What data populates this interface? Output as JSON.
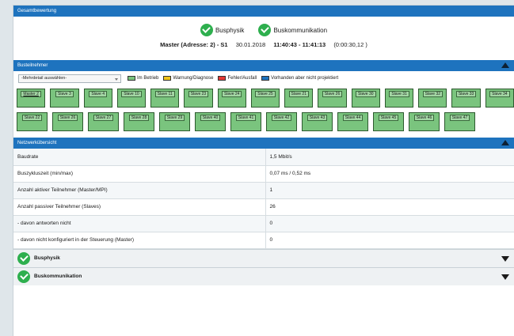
{
  "gesamtbewertung": {
    "header": "Gesamtbewertung",
    "status_items": [
      {
        "label": "Busphysik",
        "icon": "check-icon"
      },
      {
        "label": "Buskommunikation",
        "icon": "check-icon"
      }
    ],
    "master_info": {
      "text": "Master (Adresse: 2) - S1",
      "date": "30.01.2018",
      "time_range": "11:40:43 - 11:41:13",
      "duration": "(0:00:30,12 )"
    }
  },
  "busteilnehmer": {
    "header": "Busteilnehmer",
    "select_value": "-Mehrdetail auswählen-",
    "legend": [
      {
        "label": "Im Betrieb",
        "color": "#7ac47e"
      },
      {
        "label": "Warnung/Diagnose",
        "color": "#f0c419"
      },
      {
        "label": "Fehler/Ausfall",
        "color": "#e53935"
      },
      {
        "label": "Vorhanden aber nicht projektiert",
        "color": "#1e73be"
      }
    ],
    "row1": [
      "Master 2",
      "Slave 3",
      "Slave 4",
      "Slave 10",
      "Slave 11",
      "Slave 23",
      "Slave 24",
      "Slave 25",
      "Slave 21",
      "Slave 26",
      "Slave 30",
      "Slave 31",
      "Slave 32",
      "Slave 33",
      "Slave 34"
    ],
    "row2": [
      "Slave 22",
      "Slave 26",
      "Slave 27",
      "Slave 28",
      "Slave 29",
      "Slave 40",
      "Slave 41",
      "Slave 42",
      "Slave 43",
      "Slave 44",
      "Slave 45",
      "Slave 46",
      "Slave 47"
    ]
  },
  "netzwerk": {
    "header": "Netzwerkübersicht",
    "rows": [
      {
        "label": "Baudrate",
        "value": "1,5 Mbit/s"
      },
      {
        "label": "Buszykluszeit (min/max)",
        "value": "0,07 ms / 0,52 ms"
      },
      {
        "label": "Anzahl aktiver Teilnehmer (Master/MPI)",
        "value": "1"
      },
      {
        "label": "Anzahl passiver Teilnehmer (Slaves)",
        "value": "26"
      },
      {
        "label": "- davon antworten nicht",
        "value": "0"
      },
      {
        "label": "- davon nicht konfiguriert in der Steuerung (Master)",
        "value": "0"
      }
    ]
  },
  "accordions": [
    {
      "label": "Busphysik"
    },
    {
      "label": "Buskommunikation"
    }
  ],
  "colors": {
    "header_blue": "#1e73be",
    "check_green": "#2eaf4e",
    "tile_green": "#7ac47e"
  }
}
